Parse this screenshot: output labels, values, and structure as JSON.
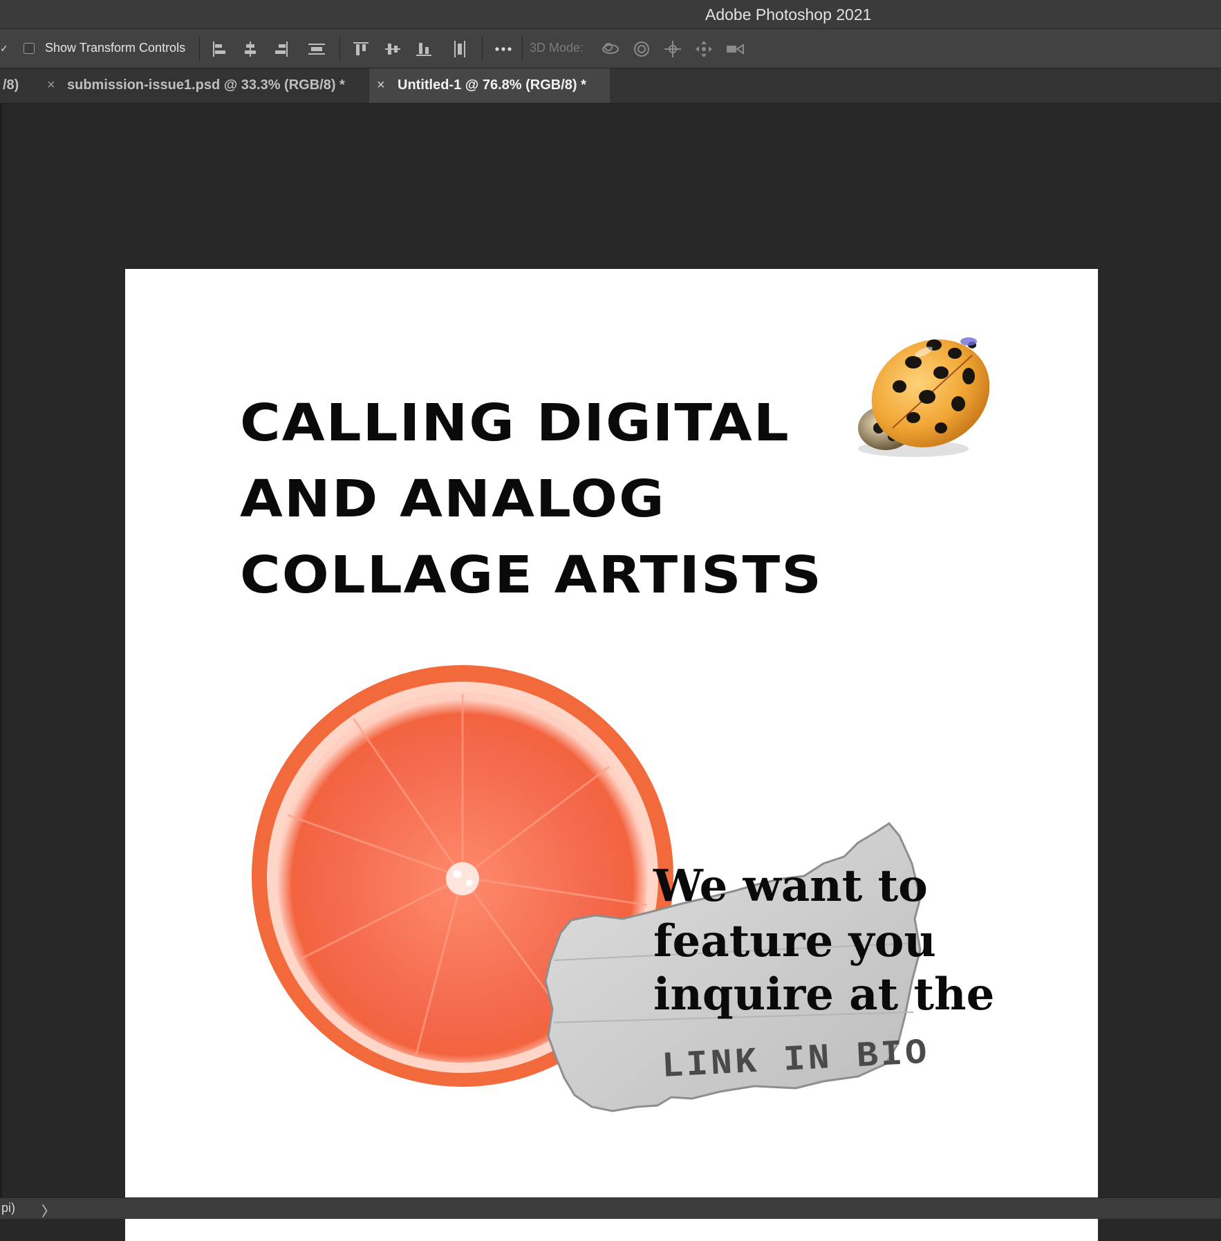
{
  "app": {
    "title": "Adobe Photoshop 2021"
  },
  "options_bar": {
    "show_transform_controls": {
      "label": "Show Transform Controls",
      "checked": false
    },
    "align_icons": [
      "align-left-edges-icon",
      "align-horizontal-centers-icon",
      "align-right-edges-icon",
      "distribute-horizontal-icon",
      "align-top-edges-icon",
      "align-vertical-centers-icon",
      "align-bottom-edges-icon",
      "distribute-vertical-icon"
    ],
    "more_icon": "more-options-icon",
    "threed_mode_label": "3D Mode:",
    "threed_icons": [
      "orbit-3d-icon",
      "roll-3d-icon",
      "drag-3d-icon",
      "slide-3d-icon",
      "scale-3d-icon"
    ]
  },
  "tabs": [
    {
      "label": "/8)",
      "active": false
    },
    {
      "label": "submission-issue1.psd @ 33.3% (RGB/8) *",
      "close": "×",
      "active": false
    },
    {
      "label": "Untitled-1 @ 76.8% (RGB/8) *",
      "close": "×",
      "active": true
    }
  ],
  "canvas": {
    "headline": [
      "CALLING DIGITAL",
      "AND ANALOG",
      "COLLAGE ARTISTS"
    ],
    "subtext": [
      "We want to",
      "feature you",
      "inquire at the"
    ],
    "paper_text": "LINK IN BIO",
    "colors": {
      "orange": "#f46a4e",
      "ladybug": "#f0a534",
      "paper": "#cfcfcf"
    }
  },
  "status": {
    "text": "pi)",
    "arrow": "〉"
  }
}
